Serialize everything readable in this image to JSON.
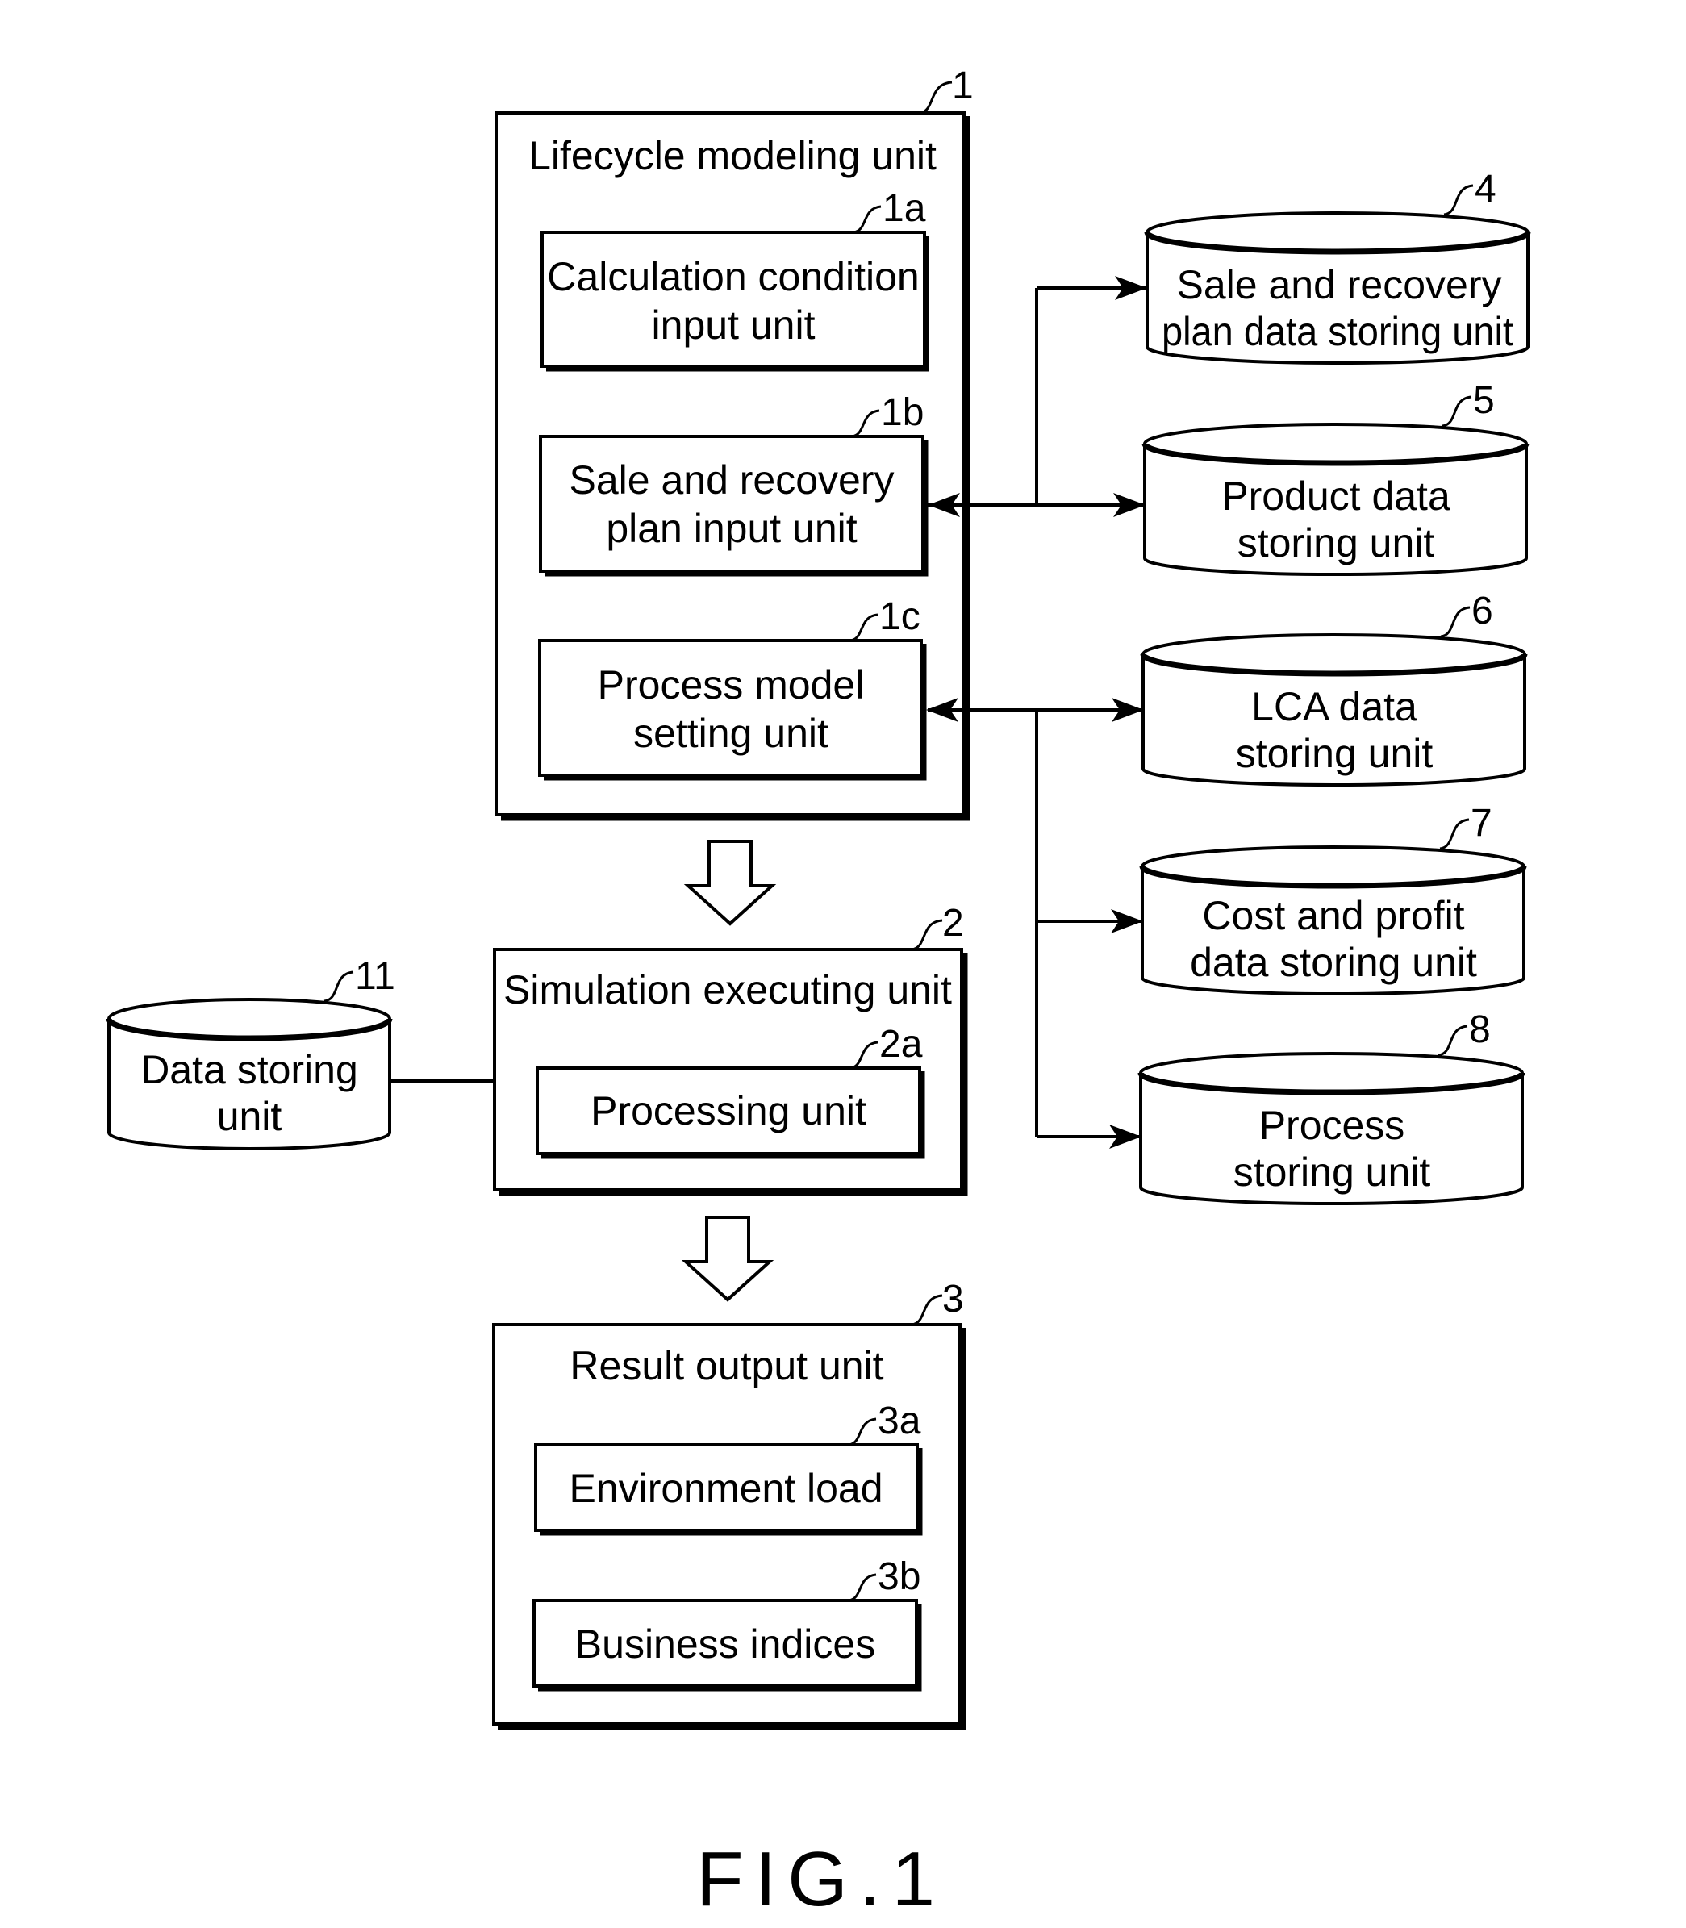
{
  "figure_label": "FIG.1",
  "units": {
    "lifecycle": {
      "ref": "1",
      "title": "Lifecycle modeling unit"
    },
    "calc_input": {
      "ref": "1a",
      "lines": [
        "Calculation condition",
        "input unit"
      ]
    },
    "sale_plan_input": {
      "ref": "1b",
      "lines": [
        "Sale and recovery",
        "plan input unit"
      ]
    },
    "process_model": {
      "ref": "1c",
      "lines": [
        "Process model",
        "setting unit"
      ]
    },
    "simulation": {
      "ref": "2",
      "title": "Simulation executing unit"
    },
    "processing": {
      "ref": "2a",
      "lines": [
        "Processing unit"
      ]
    },
    "result_output": {
      "ref": "3",
      "title": "Result output unit"
    },
    "env_load": {
      "ref": "3a",
      "lines": [
        "Environment load"
      ]
    },
    "business": {
      "ref": "3b",
      "lines": [
        "Business indices"
      ]
    }
  },
  "stores": {
    "sale_plan_data": {
      "ref": "4",
      "lines": [
        "Sale and recovery",
        "plan data storing unit"
      ]
    },
    "product_data": {
      "ref": "5",
      "lines": [
        "Product data",
        "storing unit"
      ]
    },
    "lca_data": {
      "ref": "6",
      "lines": [
        "LCA data",
        "storing unit"
      ]
    },
    "cost_profit": {
      "ref": "7",
      "lines": [
        "Cost and profit",
        "data storing unit"
      ]
    },
    "process_store": {
      "ref": "8",
      "lines": [
        "Process",
        "storing unit"
      ]
    },
    "data_store": {
      "ref": "11",
      "lines": [
        "Data storing",
        "unit"
      ]
    }
  }
}
